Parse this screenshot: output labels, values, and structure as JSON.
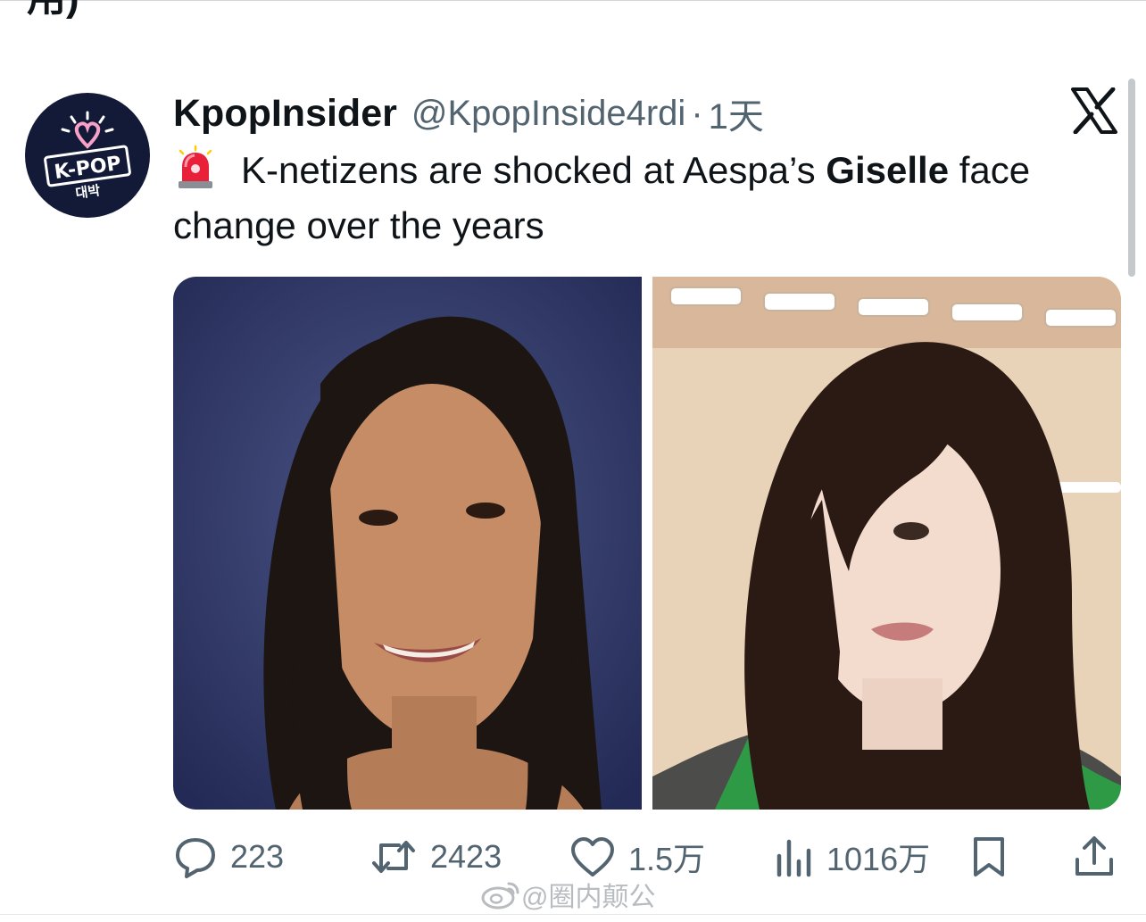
{
  "prev_text": "用)",
  "tweet": {
    "author_name": "KpopInsider",
    "author_handle": "@KpopInside4rdi",
    "separator": "·",
    "time": "1天",
    "text_part1": "K-netizens are shocked at Aespa’s ",
    "text_bold": "Giselle",
    "text_part2": " face change over the years",
    "emoji": "police-car-light-icon"
  },
  "avatar": {
    "logo_text": "K-POP",
    "sub_text": "대박"
  },
  "media": [
    {
      "alt": "yearbook-photo"
    },
    {
      "alt": "recent-photo"
    }
  ],
  "actions": {
    "replies": "223",
    "reposts": "2423",
    "likes": "1.5万",
    "views": "1016万"
  },
  "watermark": "@圈内颠公",
  "colors": {
    "text": "#0f1419",
    "secondary": "#536471",
    "avatar_bg": "#121a37",
    "accent_pink": "#f7a1c8"
  }
}
